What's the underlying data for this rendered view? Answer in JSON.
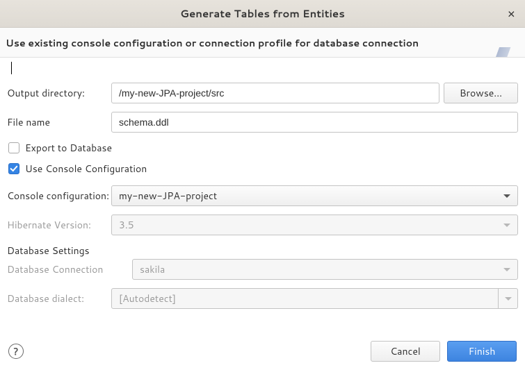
{
  "window": {
    "title": "Generate Tables from Entities"
  },
  "banner": {
    "heading": "Use existing console configuration or connection profile for database connection"
  },
  "form": {
    "outputDirectory": {
      "label": "Output directory:",
      "value": "/my-new-JPA-project/src"
    },
    "browse": {
      "label": "Browse..."
    },
    "fileName": {
      "label": "File name",
      "value": "schema.ddl"
    },
    "exportToDatabase": {
      "label": "Export to Database",
      "checked": false
    },
    "useConsoleConfig": {
      "label": "Use Console Configuration",
      "checked": true
    },
    "consoleConfig": {
      "label": "Console configuration:",
      "value": "my-new-JPA-project"
    },
    "hibernateVersion": {
      "label": "Hibernate Version:",
      "value": "3.5"
    },
    "databaseSettings": {
      "title": "Database Settings"
    },
    "dbConnection": {
      "label": "Database Connection",
      "value": "sakila"
    },
    "dbDialect": {
      "label": "Database dialect:",
      "value": "[Autodetect]"
    }
  },
  "footer": {
    "help": "?",
    "cancel": "Cancel",
    "finish": "Finish"
  }
}
